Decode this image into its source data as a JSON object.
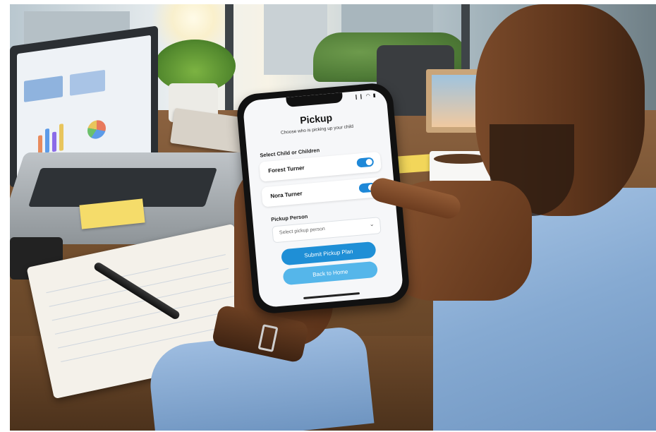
{
  "app": {
    "title": "Pickup",
    "subtitle": "Choose who is picking up your child",
    "status_icons": "❙❙ ◠ ▮"
  },
  "children_section": {
    "label": "Select Child or Children",
    "children": [
      {
        "name": "Forest Turner",
        "selected": true
      },
      {
        "name": "Nora Turner",
        "selected": true
      }
    ]
  },
  "pickup_person": {
    "label": "Pickup Person",
    "placeholder": "Select pickup person",
    "chevron_icon": "chevron-down-icon"
  },
  "buttons": {
    "submit_label": "Submit Pickup Plan",
    "back_label": "Back to Home"
  },
  "colors": {
    "primary": "#1f8fd6",
    "secondary": "#55b6ea",
    "toggle_on": "#1e88d8"
  }
}
